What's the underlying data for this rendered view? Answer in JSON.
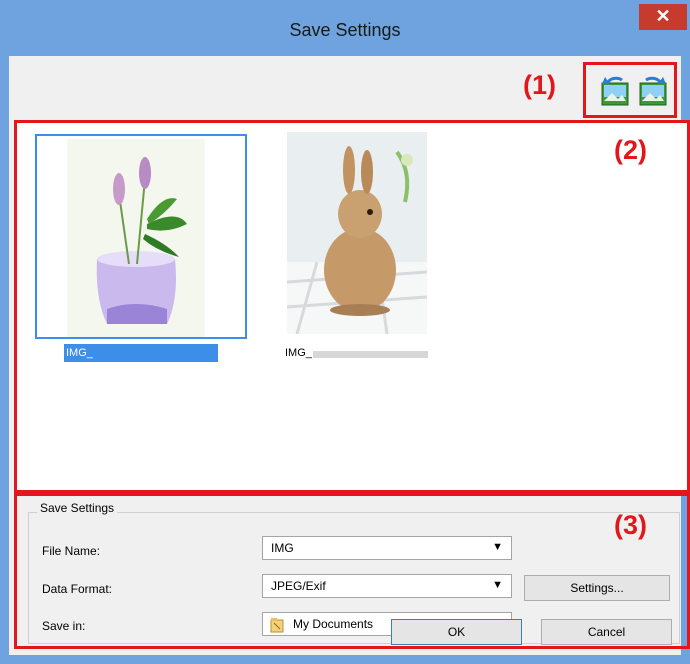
{
  "window": {
    "title": "Save Settings",
    "close_glyph": "✕"
  },
  "callouts": {
    "one": "(1)",
    "two": "(2)",
    "three": "(3)"
  },
  "toolbar": {
    "rotate_left_icon": "rotate-left-icon",
    "rotate_right_icon": "rotate-right-icon"
  },
  "images": [
    {
      "caption": "IMG_",
      "selected": true,
      "icon": "flower-vase-thumbnail"
    },
    {
      "caption": "IMG_",
      "selected": false,
      "icon": "rabbit-thumbnail"
    }
  ],
  "save_settings": {
    "group_title": "Save Settings",
    "file_name": {
      "label": "File Name:",
      "value": "IMG"
    },
    "data_format": {
      "label": "Data Format:",
      "value": "JPEG/Exif",
      "settings_button": "Settings..."
    },
    "save_in": {
      "label": "Save in:",
      "value": "My Documents",
      "icon": "folder-icon"
    }
  },
  "footer": {
    "ok": "OK",
    "cancel": "Cancel"
  },
  "colors": {
    "titlebar": "#6ea3e0",
    "close": "#c73a2e",
    "callout": "#e3161c",
    "selection": "#3d8ee8"
  }
}
